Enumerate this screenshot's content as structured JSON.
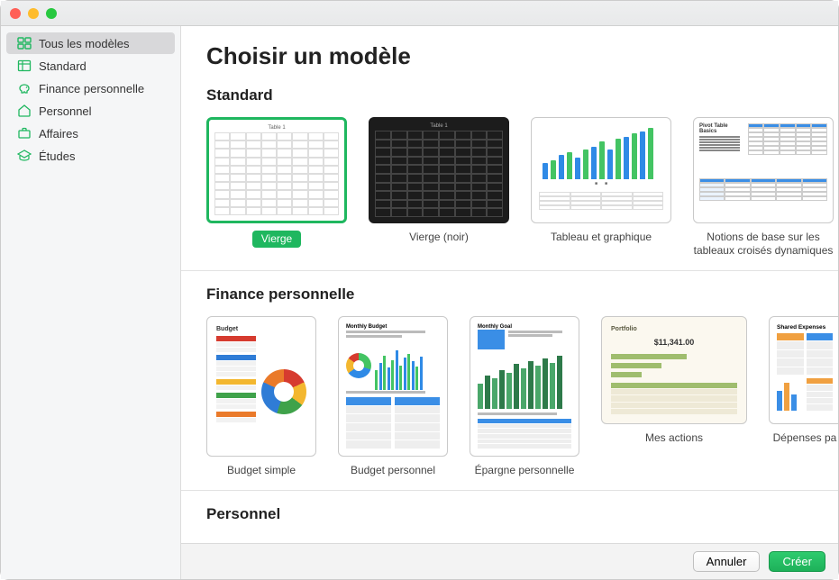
{
  "window": {
    "title": "Choisir un modèle"
  },
  "sidebar": {
    "items": [
      {
        "label": "Tous les modèles"
      },
      {
        "label": "Standard"
      },
      {
        "label": "Finance personnelle"
      },
      {
        "label": "Personnel"
      },
      {
        "label": "Affaires"
      },
      {
        "label": "Études"
      }
    ]
  },
  "page_title": "Choisir un modèle",
  "sections": {
    "standard": {
      "title": "Standard",
      "templates": [
        {
          "label": "Vierge"
        },
        {
          "label": "Vierge (noir)"
        },
        {
          "label": "Tableau et graphique"
        },
        {
          "label": "Notions de base sur les tableaux croisés dynamiques"
        }
      ]
    },
    "finance": {
      "title": "Finance personnelle",
      "templates": [
        {
          "label": "Budget simple"
        },
        {
          "label": "Budget personnel"
        },
        {
          "label": "Épargne personnelle"
        },
        {
          "label": "Mes actions"
        },
        {
          "label": "Dépenses pa"
        }
      ]
    },
    "personnel": {
      "title": "Personnel"
    }
  },
  "portfolio": {
    "title": "Portfolio",
    "amount": "$11,341.00"
  },
  "thumbnail_text": {
    "table1": "Table 1",
    "budget": "Budget",
    "monthly_budget": "Monthly Budget",
    "monthly_goal": "Monthly Goal",
    "pivot_basics": "Pivot Table Basics",
    "shared_expenses": "Shared Expenses"
  },
  "footer": {
    "cancel": "Annuler",
    "create": "Créer"
  },
  "colors": {
    "accent": "#1fb75f"
  }
}
